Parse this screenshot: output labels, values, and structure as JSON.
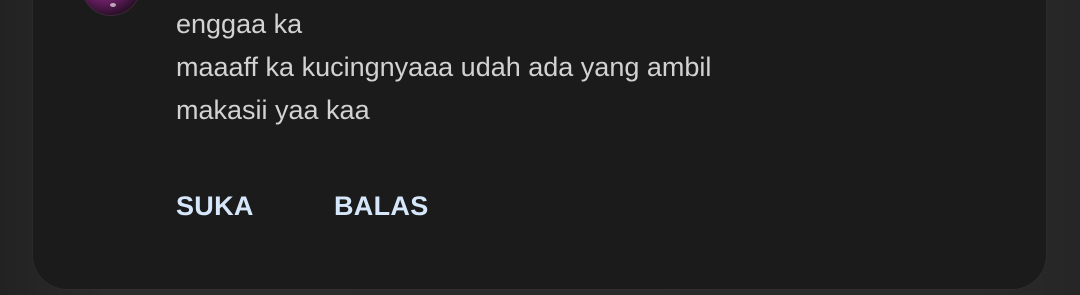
{
  "comment": {
    "lines": [
      "enggaa ka",
      "maaaff ka kucingnyaaa udah ada yang ambil",
      "makasii yaa kaa"
    ]
  },
  "actions": {
    "like_label": "SUKA",
    "reply_label": "BALAS"
  },
  "colors": {
    "background": "#2a2a2a",
    "card": "#1b1b1b",
    "text": "#d2d2d2",
    "action": "#d6e7fb"
  }
}
